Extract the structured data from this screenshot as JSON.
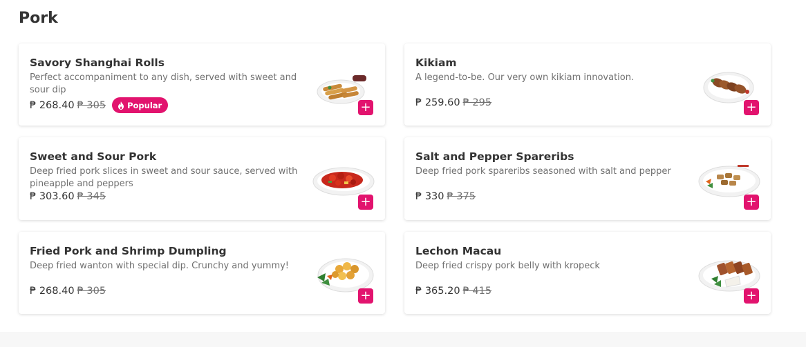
{
  "section": {
    "title": "Pork"
  },
  "colors": {
    "accent": "#e2136e",
    "text": "#333333",
    "muted": "#707070"
  },
  "items": [
    {
      "name": "Savory Shanghai Rolls",
      "description": "Perfect accompaniment to any dish, served with sweet and sour dip",
      "price": "₱ 268.40",
      "old_price": "₱ 305",
      "badge": "Popular",
      "image": "shanghai-rolls-image",
      "add_label": "+"
    },
    {
      "name": "Kikiam",
      "description": "A legend-to-be. Our very own kikiam innovation.",
      "price": "₱ 259.60",
      "old_price": "₱ 295",
      "image": "kikiam-image",
      "add_label": "+"
    },
    {
      "name": "Sweet and Sour Pork",
      "description": "Deep fried pork slices in sweet and sour sauce, served with pineapple and peppers",
      "price": "₱ 303.60",
      "old_price": "₱ 345",
      "image": "sweet-sour-pork-image",
      "add_label": "+"
    },
    {
      "name": "Salt and Pepper Spareribs",
      "description": "Deep fried pork spareribs seasoned with salt and pepper",
      "price": "₱ 330",
      "old_price": "₱ 375",
      "image": "spareribs-image",
      "add_label": "+"
    },
    {
      "name": "Fried Pork and Shrimp Dumpling",
      "description": "Deep fried wanton with special dip. Crunchy and yummy!",
      "price": "₱ 268.40",
      "old_price": "₱ 305",
      "image": "dumpling-image",
      "add_label": "+"
    },
    {
      "name": "Lechon Macau",
      "description": "Deep fried crispy pork belly with kropeck",
      "price": "₱ 365.20",
      "old_price": "₱ 415",
      "image": "lechon-macau-image",
      "add_label": "+"
    }
  ]
}
